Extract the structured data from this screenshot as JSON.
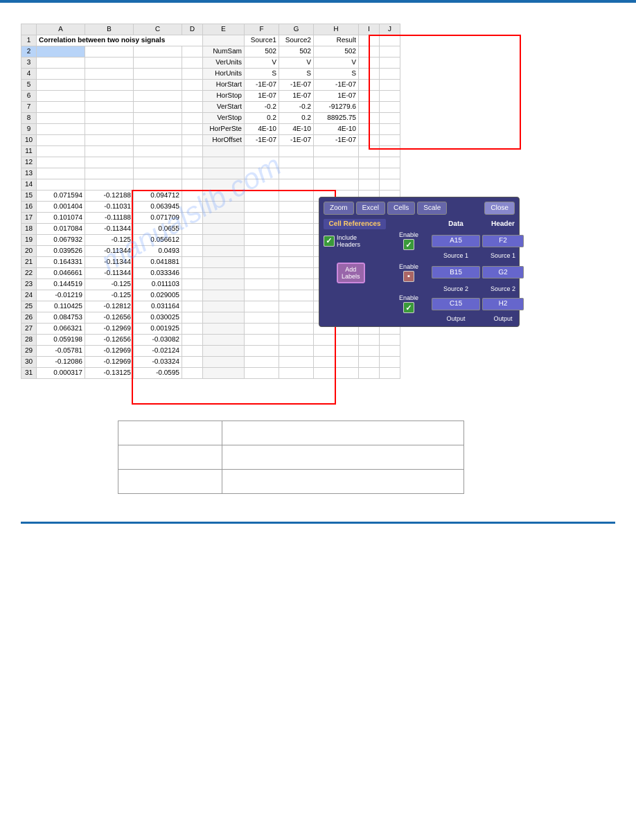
{
  "topbar": {
    "color": "#1a6aad"
  },
  "spreadsheet": {
    "title": "Correlation between two noisy signals",
    "col_headers": [
      "",
      "A",
      "B",
      "C",
      "D",
      "E",
      "F",
      "G",
      "H",
      "I",
      "J"
    ],
    "rows": [
      {
        "row": 1,
        "cells": [
          "Correlation between two noisy signals",
          "",
          "",
          "",
          "",
          "Source1",
          "Source2",
          "Result",
          "",
          ""
        ]
      },
      {
        "row": 2,
        "cells": [
          "",
          "",
          "",
          "",
          "NumSam",
          "502",
          "502",
          "502",
          "",
          ""
        ]
      },
      {
        "row": 3,
        "cells": [
          "",
          "",
          "",
          "",
          "VerUnits",
          "V",
          "V",
          "V",
          "",
          ""
        ]
      },
      {
        "row": 4,
        "cells": [
          "",
          "",
          "",
          "",
          "HorUnits",
          "S",
          "S",
          "S",
          "",
          ""
        ]
      },
      {
        "row": 5,
        "cells": [
          "",
          "",
          "",
          "",
          "HorStart",
          "-1E-07",
          "-1E-07",
          "-1E-07",
          "",
          ""
        ]
      },
      {
        "row": 6,
        "cells": [
          "",
          "",
          "",
          "",
          "HorStop",
          "1E-07",
          "1E-07",
          "1E-07",
          "",
          ""
        ]
      },
      {
        "row": 7,
        "cells": [
          "",
          "",
          "",
          "",
          "VerStart",
          "-0.2",
          "-0.2",
          "-91279.6",
          "",
          ""
        ]
      },
      {
        "row": 8,
        "cells": [
          "",
          "",
          "",
          "",
          "VerStop",
          "0.2",
          "0.2",
          "88925.75",
          "",
          ""
        ]
      },
      {
        "row": 9,
        "cells": [
          "",
          "",
          "",
          "",
          "HorPerSte",
          "4E-10",
          "4E-10",
          "4E-10",
          "",
          ""
        ]
      },
      {
        "row": 10,
        "cells": [
          "",
          "",
          "",
          "",
          "HorOffset",
          "-1E-07",
          "-1E-07",
          "-1E-07",
          "",
          ""
        ]
      },
      {
        "row": 11,
        "cells": [
          "",
          "",
          "",
          "",
          "",
          "",
          "",
          "",
          "",
          ""
        ]
      },
      {
        "row": 12,
        "cells": [
          "",
          "",
          "",
          "",
          "",
          "",
          "",
          "",
          "",
          ""
        ]
      },
      {
        "row": 13,
        "cells": [
          "",
          "",
          "",
          "",
          "",
          "",
          "",
          "",
          "",
          ""
        ]
      },
      {
        "row": 14,
        "cells": [
          "",
          "",
          "",
          "",
          "",
          "",
          "",
          "",
          "",
          ""
        ]
      },
      {
        "row": 15,
        "cells": [
          "0.071594",
          "-0.12188",
          "0.094712",
          "",
          "",
          "",
          "",
          "",
          "",
          ""
        ]
      },
      {
        "row": 16,
        "cells": [
          "0.001404",
          "-0.11031",
          "0.063945",
          "",
          "",
          "",
          "",
          "",
          "",
          ""
        ]
      },
      {
        "row": 17,
        "cells": [
          "0.101074",
          "-0.11188",
          "0.071709",
          "",
          "",
          "",
          "",
          "",
          "",
          ""
        ]
      },
      {
        "row": 18,
        "cells": [
          "0.017084",
          "-0.11344",
          "0.0655",
          "",
          "",
          "",
          "",
          "",
          "",
          ""
        ]
      },
      {
        "row": 19,
        "cells": [
          "0.067932",
          "-0.125",
          "0.056612",
          "",
          "",
          "",
          "",
          "",
          "",
          ""
        ]
      },
      {
        "row": 20,
        "cells": [
          "0.039526",
          "-0.11344",
          "0.0493",
          "",
          "",
          "",
          "",
          "",
          "",
          ""
        ]
      },
      {
        "row": 21,
        "cells": [
          "0.164331",
          "-0.11344",
          "0.041881",
          "",
          "",
          "",
          "",
          "",
          "",
          ""
        ]
      },
      {
        "row": 22,
        "cells": [
          "0.046661",
          "-0.11344",
          "0.033346",
          "",
          "",
          "",
          "",
          "",
          "",
          ""
        ]
      },
      {
        "row": 23,
        "cells": [
          "0.144519",
          "-0.125",
          "0.011103",
          "",
          "",
          "",
          "",
          "",
          "",
          ""
        ]
      },
      {
        "row": 24,
        "cells": [
          "-0.01219",
          "-0.125",
          "0.029005",
          "",
          "",
          "",
          "",
          "",
          "",
          ""
        ]
      },
      {
        "row": 25,
        "cells": [
          "0.110425",
          "-0.12812",
          "0.031164",
          "",
          "",
          "",
          "",
          "",
          "",
          ""
        ]
      },
      {
        "row": 26,
        "cells": [
          "0.084753",
          "-0.12656",
          "0.030025",
          "",
          "",
          "",
          "",
          "",
          "",
          ""
        ]
      },
      {
        "row": 27,
        "cells": [
          "0.066321",
          "-0.12969",
          "0.001925",
          "",
          "",
          "",
          "",
          "",
          "",
          ""
        ]
      },
      {
        "row": 28,
        "cells": [
          "0.059198",
          "-0.12656",
          "-0.03082",
          "",
          "",
          "",
          "",
          "",
          "",
          ""
        ]
      },
      {
        "row": 29,
        "cells": [
          "-0.05781",
          "-0.12969",
          "-0.02124",
          "",
          "",
          "",
          "",
          "",
          "",
          ""
        ]
      },
      {
        "row": 30,
        "cells": [
          "-0.12086",
          "-0.12969",
          "-0.03324",
          "",
          "",
          "",
          "",
          "",
          "",
          ""
        ]
      },
      {
        "row": 31,
        "cells": [
          "0.000317",
          "-0.13125",
          "-0.0595",
          "",
          "",
          "",
          "",
          "",
          "",
          ""
        ]
      }
    ]
  },
  "toolbar": {
    "zoom_label": "Zoom",
    "excel_label": "Excel",
    "cells_label": "Cells",
    "scale_label": "Scale",
    "close_label": "Close",
    "cell_references_label": "Cell References",
    "data_label": "Data",
    "header_label": "Header",
    "include_headers_label": "Include\nHeaders",
    "add_labels_label": "Add\nLabels",
    "enable_label": "Enable",
    "source1_data_cell": "A15",
    "source2_data_cell": "B15",
    "output_data_cell": "C15",
    "source1_header_cell": "F2",
    "source2_header_cell": "G2",
    "output_header_cell": "H2",
    "source1_row_label": "Source 1",
    "source2_row_label": "Source 2",
    "output_row_label": "Output"
  },
  "bottom_table": {
    "rows": [
      [
        "",
        ""
      ],
      [
        "",
        ""
      ],
      [
        "",
        ""
      ]
    ]
  },
  "watermark": "manualslib.com"
}
